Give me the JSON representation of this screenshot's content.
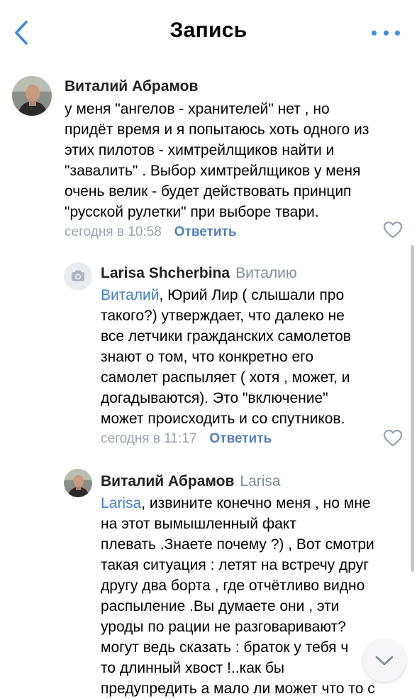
{
  "header": {
    "title": "Запись"
  },
  "comments": [
    {
      "author": "Виталий Абрамов",
      "reply_to": "",
      "mention": "",
      "text": "у меня \"ангелов - хранителей\" нет , но\nпридёт время и я попытаюсь хоть одного из\nэтих пилотов - химтрейлщиков найти и\n\"завалить\" . Выбор химтрейлщиков у меня\nочень велик - будет действовать принцип\n\"русской рулетки\" при выборе твари.",
      "time": "сегодня в 10:58",
      "reply_label": "Ответить"
    },
    {
      "author": "Larisa Shcherbina",
      "reply_to": "Виталию",
      "mention": "Виталий",
      "text": ",  Юрий Лир  ( слышали про\nтакого?) утверждает,  что далеко не\nвсе летчики  гражданских самолетов\nзнают о том, что конкретно его\nсамолет распыляет ( хотя , может, и\nдогадываются). Это \"включение\"\nможет  происходить  и  со спутников.",
      "time": "сегодня в 11:17",
      "reply_label": "Ответить"
    },
    {
      "author": "Виталий Абрамов",
      "reply_to": "Larisa",
      "mention": "Larisa",
      "text": ", извините конечно меня , но мне\nна этот вымышленный факт\nплевать .Знаете почему ?) , Вот смотри\nтакая ситуация : летят на встречу друг\nдругу два борта , где отчётливо видно\nраспыление .Вы думаете они , эти\nуроды по рации не разговаривают?\nмогут ведь сказать : браток у тебя ч\nто длинный хвост !..как бы\nпредупредить а мало ли может что то с",
      "time": "",
      "reply_label": ""
    }
  ],
  "icons": {
    "back": "chevron-left-icon",
    "more": "more-dots-icon",
    "like": "heart-outline-icon",
    "camera": "camera-icon",
    "scroll_down": "chevron-down-icon"
  },
  "colors": {
    "accent": "#3f8ae0",
    "link": "#5181b8",
    "meta": "#99a2ad",
    "mention": "#3f7fc4"
  }
}
